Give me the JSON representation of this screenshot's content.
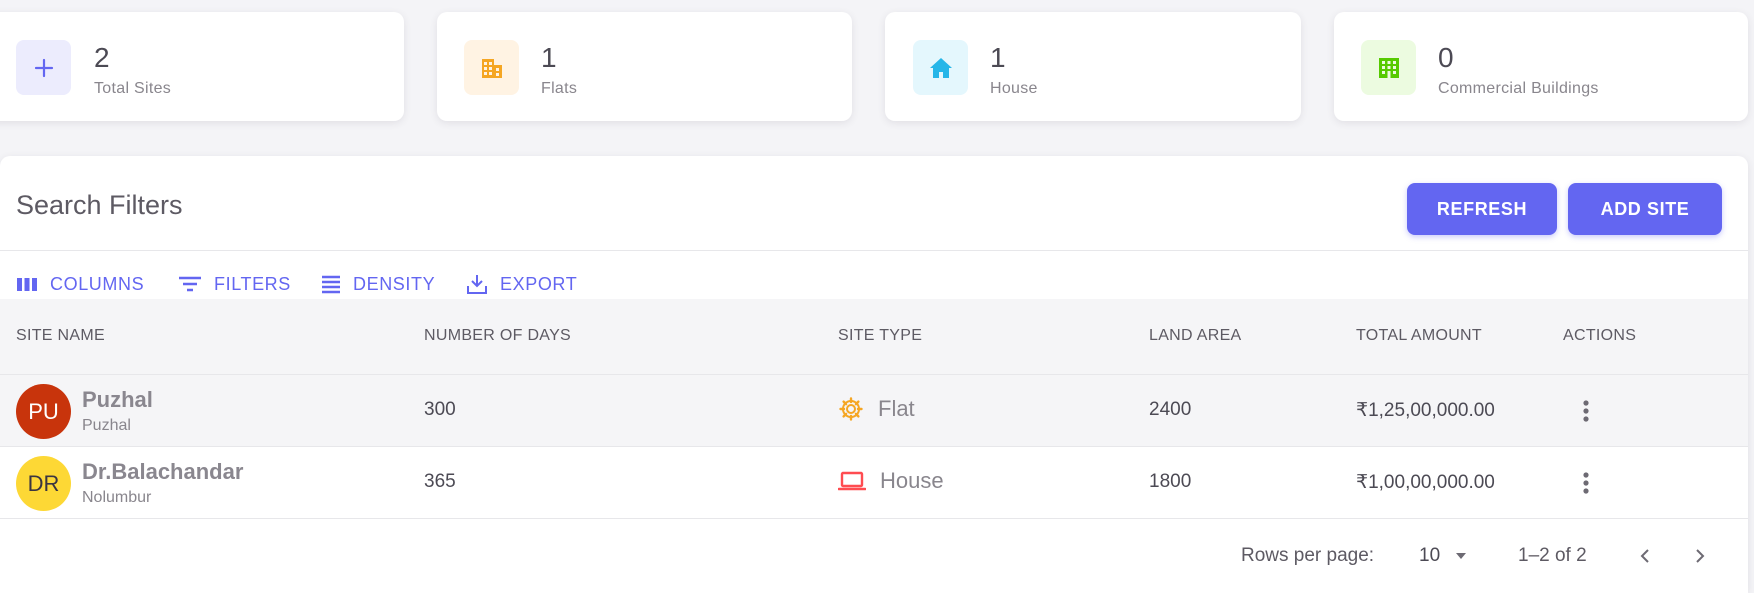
{
  "stats": [
    {
      "value": "2",
      "label": "Total Sites",
      "icon": "plus-icon",
      "color": "#6366f1",
      "bg": "#ececfd"
    },
    {
      "value": "1",
      "label": "Flats",
      "icon": "building-icon",
      "color": "#f5a623",
      "bg": "#fff3e3"
    },
    {
      "value": "1",
      "label": "House",
      "icon": "home-icon",
      "color": "#26b6e8",
      "bg": "#e4f7fd"
    },
    {
      "value": "0",
      "label": "Commercial Buildings",
      "icon": "commercial-building-icon",
      "color": "#56ca00",
      "bg": "#ecfbe0"
    }
  ],
  "panel": {
    "title": "Search Filters",
    "refresh_label": "REFRESH",
    "add_site_label": "ADD SITE"
  },
  "toolbar": {
    "columns_label": "COLUMNS",
    "filters_label": "FILTERS",
    "density_label": "DENSITY",
    "export_label": "EXPORT"
  },
  "table": {
    "headers": [
      "SITE NAME",
      "NUMBER OF DAYS",
      "SITE TYPE",
      "LAND AREA",
      "TOTAL AMOUNT",
      "ACTIONS"
    ],
    "rows": [
      {
        "initials": "PU",
        "avatar_color": "#c8340c",
        "avatar_text_color": "#ffffff",
        "name": "Puzhal",
        "location": "Puzhal",
        "days": "300",
        "site_type": "Flat",
        "site_type_icon": "gear-icon",
        "site_type_color": "#f5a623",
        "land_area": "2400",
        "total_amount": "₹1,25,00,000.00"
      },
      {
        "initials": "DR",
        "avatar_color": "#fdd835",
        "avatar_text_color": "#3a3541",
        "name": "Dr.Balachandar",
        "location": "Nolumbur",
        "days": "365",
        "site_type": "House",
        "site_type_icon": "laptop-icon",
        "site_type_color": "#ff4c51",
        "land_area": "1800",
        "total_amount": "₹1,00,00,000.00"
      }
    ]
  },
  "footer": {
    "rows_per_page_label": "Rows per page:",
    "rows_per_page_value": "10",
    "range_text": "1–2 of 2"
  },
  "colors": {
    "accent": "#6366f1"
  }
}
